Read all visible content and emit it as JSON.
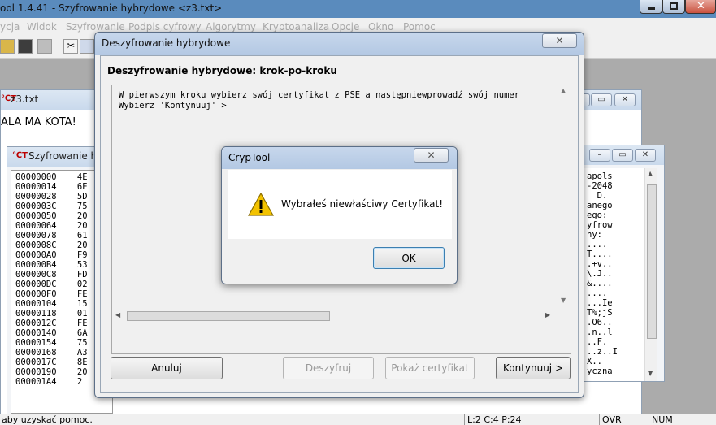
{
  "app": {
    "title": "ool 1.4.41 - Szyfrowanie hybrydowe <z3.txt>",
    "menu": [
      "ycja",
      "Widok",
      "Szyfrowanie",
      "Podpis cyfrowy",
      "Algorytmy",
      "Kryptoanaliza",
      "Opcje",
      "Okno",
      "Pomoc"
    ]
  },
  "status": {
    "help": "aby uzyskać pomoc.",
    "pos": "L:2  C:4  P:24",
    "ovr": "OVR",
    "num": "NUM"
  },
  "z3": {
    "title": "z3.txt",
    "content": "ALA MA KOTA!"
  },
  "hexwin": {
    "title": "Szyfrowanie hyb",
    "offsets": [
      "00000000",
      "00000014",
      "00000028",
      "0000003C",
      "00000050",
      "00000064",
      "00000078",
      "0000008C",
      "000000A0",
      "000000B4",
      "000000C8",
      "000000DC",
      "000000F0",
      "00000104",
      "00000118",
      "0000012C",
      "00000140",
      "00000154",
      "00000168",
      "0000017C",
      "00000190",
      "000001A4"
    ],
    "bytes": [
      "4E",
      "6E",
      "5D",
      "75",
      "20",
      "20",
      "61",
      "20",
      "F9",
      "53",
      "FD",
      "02",
      "FE",
      "15",
      "01",
      "FE",
      "6A",
      "75",
      "A3",
      "8E",
      "20",
      "2"
    ]
  },
  "rightwin": {
    "lines": [
      "apols",
      "-2048",
      "  D.",
      "anego",
      "ego:",
      "yfrow",
      "ny:",
      "....",
      "T....",
      ".+v..",
      "\\.J..",
      "&....",
      "....",
      "...Ie",
      "T%;jS",
      ".O6..",
      ".n..l",
      "..F.",
      "..z..I",
      "X..",
      "yczna"
    ]
  },
  "dialog": {
    "title": "Deszyfrowanie hybrydowe",
    "heading": "Deszyfrowanie hybrydowe: krok-po-kroku",
    "text_lines": [
      "W pierwszym kroku wybierz swój certyfikat z PSE a następniewprowadź swój numer",
      "Wybierz 'Kontynuuj' >"
    ],
    "buttons": {
      "cancel": "Anuluj",
      "decrypt": "Deszyfruj",
      "show_cert": "Pokaż certyfikat",
      "continue": "Kontynuuj >"
    }
  },
  "msgbox": {
    "title": "CrypTool",
    "message": "Wybrałeś niewłaściwy Certyfikat!",
    "ok": "OK"
  },
  "colors": {
    "warning": "#f2c200",
    "title_bar": "#b3c8e3"
  }
}
